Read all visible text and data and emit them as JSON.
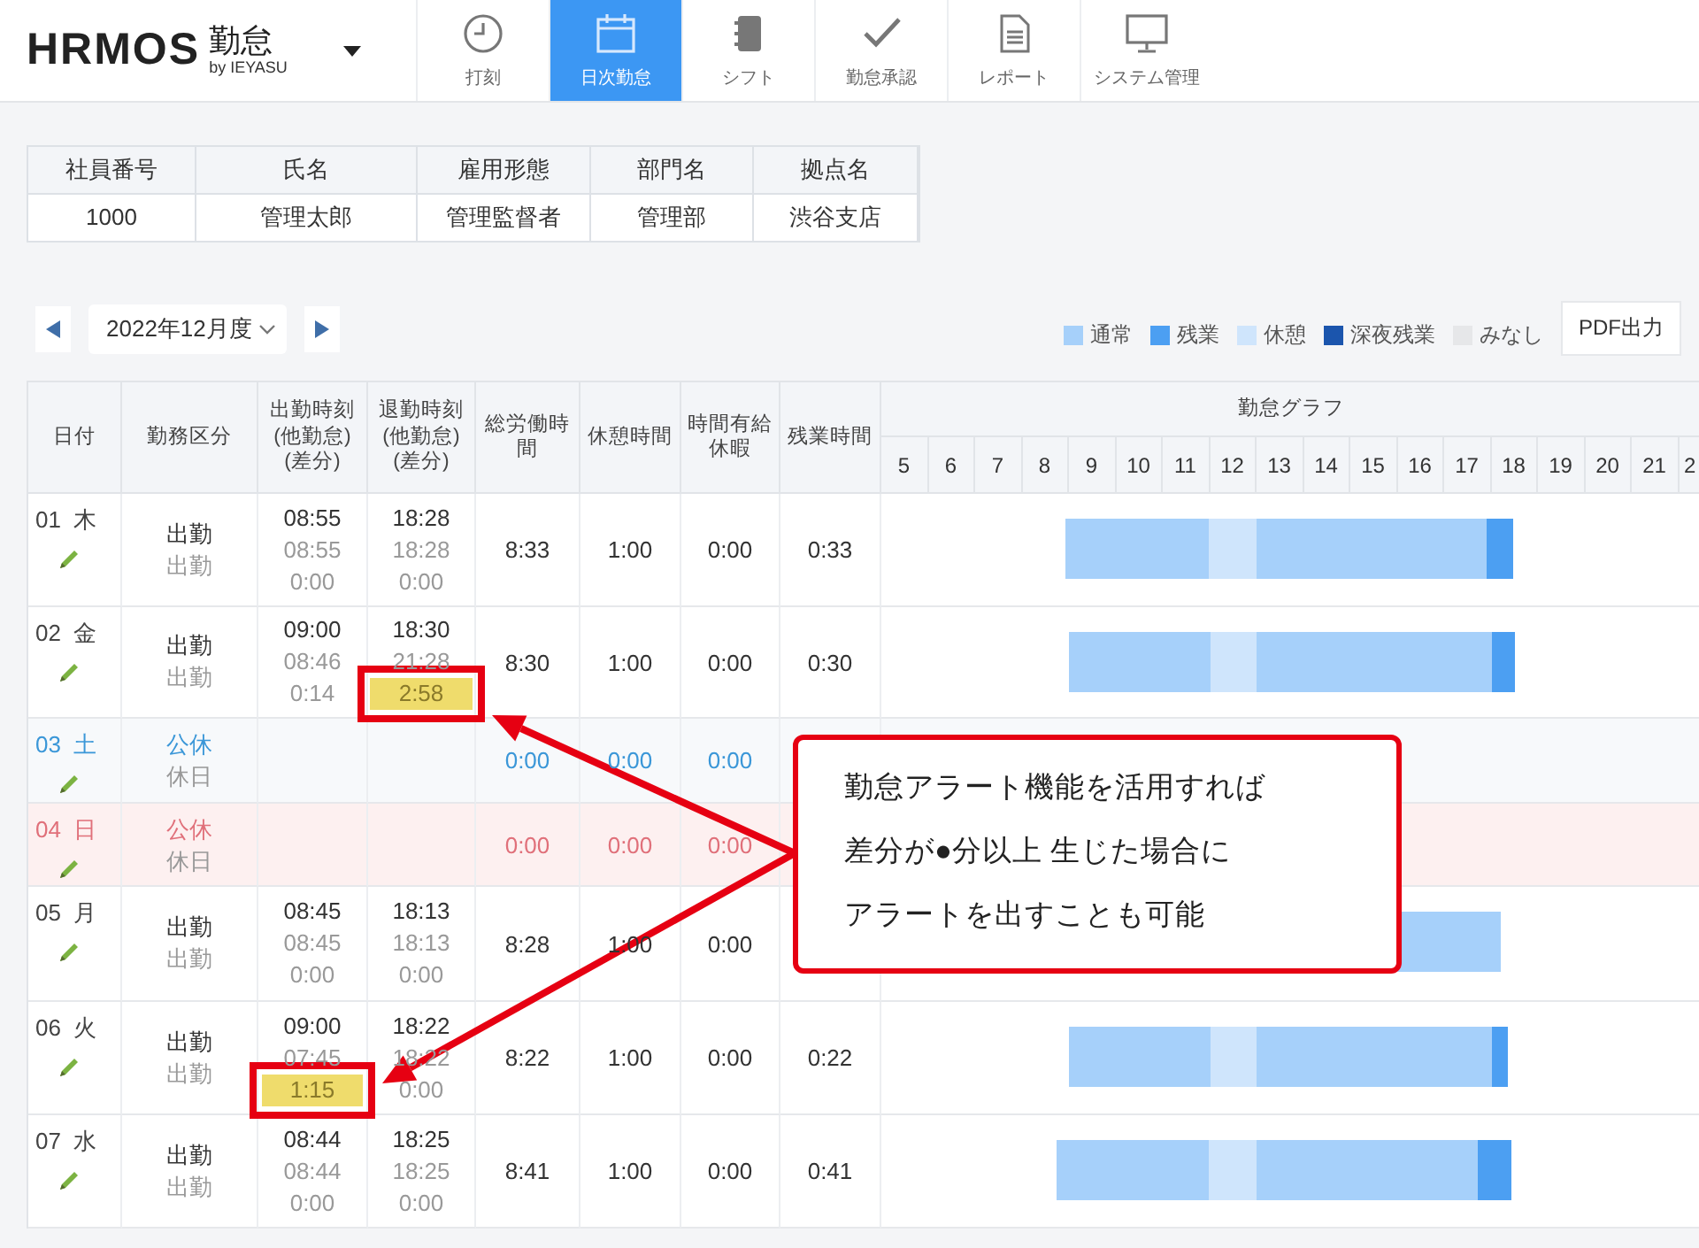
{
  "header": {
    "logo": "HRMOS",
    "product": "勤怠",
    "byline": "by IEYASU",
    "tabs": [
      {
        "label": "打刻",
        "selected": false
      },
      {
        "label": "日次勤怠",
        "selected": true
      },
      {
        "label": "シフト",
        "selected": false
      },
      {
        "label": "勤怠承認",
        "selected": false
      },
      {
        "label": "レポート",
        "selected": false
      },
      {
        "label": "システム管理",
        "selected": false
      }
    ]
  },
  "employee": {
    "columns": [
      "社員番号",
      "氏名",
      "雇用形態",
      "部門名",
      "拠点名"
    ],
    "values": [
      "1000",
      "管理太郎",
      "管理監督者",
      "管理部",
      "渋谷支店"
    ]
  },
  "period": "2022年12月度",
  "legend": [
    {
      "label": "通常",
      "color": "#a6d0fa"
    },
    {
      "label": "残業",
      "color": "#4c9ff2"
    },
    {
      "label": "休憩",
      "color": "#cfe5fc"
    },
    {
      "label": "深夜残業",
      "color": "#1b55ad"
    },
    {
      "label": "みなし",
      "color": "#e6e7e9"
    }
  ],
  "pdf_button": "PDF出力",
  "table": {
    "columns": [
      "日付",
      "勤務区分",
      "出勤時刻(他勤怠)(差分)",
      "退勤時刻(他勤怠)(差分)",
      "総労働時間",
      "休憩時間",
      "時間有給休暇",
      "残業時間"
    ],
    "graph_title": "勤怠グラフ",
    "hours": [
      "5",
      "6",
      "7",
      "8",
      "9",
      "10",
      "11",
      "12",
      "13",
      "14",
      "15",
      "16",
      "17",
      "18",
      "19",
      "20",
      "21",
      "2"
    ],
    "rows": [
      {
        "date": "01",
        "weekday": "木",
        "kind": "workday",
        "type": "出勤",
        "type_sub": "出勤",
        "in": [
          "08:55",
          "08:55",
          "0:00"
        ],
        "out": [
          "18:28",
          "18:28",
          "0:00"
        ],
        "in_alert": false,
        "out_alert": false,
        "total": "8:33",
        "break": "1:00",
        "paid": "0:00",
        "overtime": "0:33"
      },
      {
        "date": "02",
        "weekday": "金",
        "kind": "workday",
        "type": "出勤",
        "type_sub": "出勤",
        "in": [
          "09:00",
          "08:46",
          "0:14"
        ],
        "out": [
          "18:30",
          "21:28",
          "2:58"
        ],
        "in_alert": false,
        "out_alert": true,
        "total": "8:30",
        "break": "1:00",
        "paid": "0:00",
        "overtime": "0:30"
      },
      {
        "date": "03",
        "weekday": "土",
        "kind": "saturday",
        "type": "公休",
        "type_sub": "休日",
        "total": "0:00",
        "break": "0:00",
        "paid": "0:00"
      },
      {
        "date": "04",
        "weekday": "日",
        "kind": "sunday",
        "type": "公休",
        "type_sub": "休日",
        "total": "0:00",
        "break": "0:00",
        "paid": "0:00"
      },
      {
        "date": "05",
        "weekday": "月",
        "kind": "workday",
        "type": "出勤",
        "type_sub": "出勤",
        "in": [
          "08:45",
          "08:45",
          "0:00"
        ],
        "out": [
          "18:13",
          "18:13",
          "0:00"
        ],
        "in_alert": false,
        "out_alert": false,
        "total": "8:28",
        "break": "1:00",
        "paid": "0:00"
      },
      {
        "date": "06",
        "weekday": "火",
        "kind": "workday",
        "type": "出勤",
        "type_sub": "出勤",
        "in": [
          "09:00",
          "07:45",
          "1:15"
        ],
        "out": [
          "18:22",
          "18:22",
          "0:00"
        ],
        "in_alert": true,
        "out_alert": false,
        "total": "8:22",
        "break": "1:00",
        "paid": "0:00",
        "overtime": "0:22"
      },
      {
        "date": "07",
        "weekday": "水",
        "kind": "workday",
        "type": "出勤",
        "type_sub": "出勤",
        "in": [
          "08:44",
          "08:44",
          "0:00"
        ],
        "out": [
          "18:25",
          "18:25",
          "0:00"
        ],
        "in_alert": false,
        "out_alert": false,
        "total": "8:41",
        "break": "1:00",
        "paid": "0:00",
        "overtime": "0:41"
      }
    ]
  },
  "callout": {
    "lines": [
      "勤怠アラート機能を活用すれば",
      "差分が●分以上 生じた場合に",
      "アラートを出すことも可能"
    ]
  }
}
